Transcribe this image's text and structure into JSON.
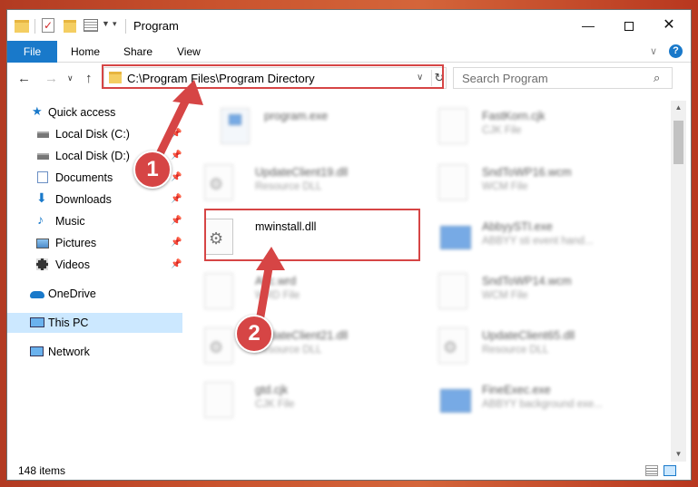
{
  "window": {
    "title": "Program"
  },
  "ribbon": {
    "file": "File",
    "home": "Home",
    "share": "Share",
    "view": "View",
    "help": "?"
  },
  "address": {
    "path": "C:\\Program Files\\Program Directory",
    "search_placeholder": "Search Program"
  },
  "sidebar": {
    "items": [
      {
        "label": "Quick access",
        "icon": "star-icon",
        "pinned": false
      },
      {
        "label": "Local Disk (C:)",
        "icon": "drive-icon",
        "pinned": true
      },
      {
        "label": "Local Disk (D:)",
        "icon": "drive-icon",
        "pinned": true
      },
      {
        "label": "Documents",
        "icon": "documents-icon",
        "pinned": true
      },
      {
        "label": "Downloads",
        "icon": "download-icon",
        "pinned": true
      },
      {
        "label": "Music",
        "icon": "music-icon",
        "pinned": true
      },
      {
        "label": "Pictures",
        "icon": "pictures-icon",
        "pinned": true
      },
      {
        "label": "Videos",
        "icon": "videos-icon",
        "pinned": true
      },
      {
        "label": "OneDrive",
        "icon": "cloud-icon",
        "pinned": false
      },
      {
        "label": "This PC",
        "icon": "computer-icon",
        "pinned": false,
        "selected": true
      },
      {
        "label": "Network",
        "icon": "network-icon",
        "pinned": false
      }
    ]
  },
  "files": {
    "left": [
      {
        "name": "program.exe",
        "type": ""
      },
      {
        "name": "UpdateClient19.dll",
        "type": "Resource DLL"
      },
      {
        "name": "mwinstall.dll",
        "type": ""
      },
      {
        "name": "Abc.wrd",
        "type": "WRD File"
      },
      {
        "name": "UpdateClient21.dll",
        "type": "Resource DLL"
      },
      {
        "name": "gtd.cjk",
        "type": "CJK File"
      }
    ],
    "right": [
      {
        "name": "FastKorn.cjk",
        "type": "CJK File"
      },
      {
        "name": "SndToWP16.wcm",
        "type": "WCM File"
      },
      {
        "name": "AbbyySTI.exe",
        "type": "ABBYY sti event hand..."
      },
      {
        "name": "SndToWP14.wcm",
        "type": "WCM File"
      },
      {
        "name": "UpdateClient65.dll",
        "type": "Resource DLL"
      },
      {
        "name": "FineExec.exe",
        "type": "ABBYY background exe..."
      }
    ]
  },
  "status": {
    "count": "148 items"
  },
  "callouts": {
    "one": "1",
    "two": "2"
  },
  "colors": {
    "accent": "#1979ca",
    "highlight": "#d64545",
    "selected": "#cce8ff"
  }
}
